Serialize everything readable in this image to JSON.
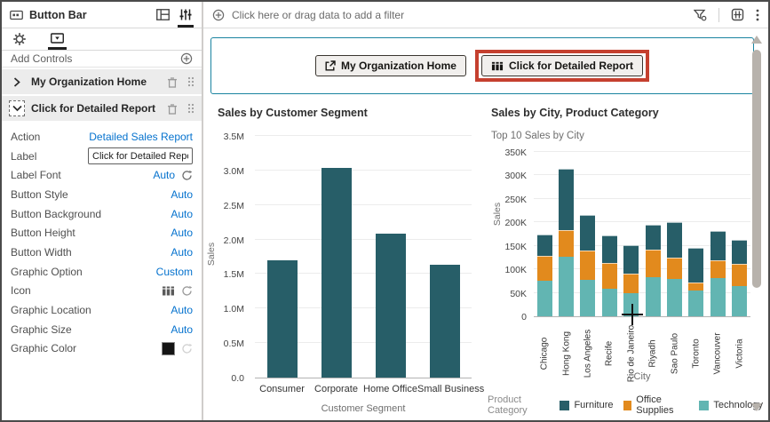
{
  "sidebar": {
    "title": "Button Bar",
    "add_controls_label": "Add Controls",
    "controls": [
      {
        "label": "My Organization Home",
        "state": "collapsed"
      },
      {
        "label": "Click for Detailed Report",
        "state": "selected"
      }
    ],
    "properties": [
      {
        "label": "Action",
        "value": "Detailed Sales Report"
      },
      {
        "label": "Label",
        "value": "Click for Detailed Report"
      },
      {
        "label": "Label Font",
        "value": "Auto"
      },
      {
        "label": "Button Style",
        "value": "Auto"
      },
      {
        "label": "Button Background",
        "value": "Auto"
      },
      {
        "label": "Button Height",
        "value": "Auto"
      },
      {
        "label": "Button Width",
        "value": "Auto"
      },
      {
        "label": "Graphic Option",
        "value": "Custom"
      },
      {
        "label": "Icon",
        "value": "table-icon"
      },
      {
        "label": "Graphic Location",
        "value": "Auto"
      },
      {
        "label": "Graphic Size",
        "value": "Auto"
      },
      {
        "label": "Graphic Color",
        "value": "#141414"
      }
    ]
  },
  "filter_bar": {
    "prompt": "Click here or drag data to add a filter"
  },
  "canvas": {
    "buttons": [
      {
        "label": "My Organization Home",
        "icon": "open-in-new-icon"
      },
      {
        "label": "Click for Detailed Report",
        "icon": "table-icon",
        "highlighted": true
      }
    ],
    "annotation": {
      "type": "highlight-box",
      "color": "#C5402F",
      "target": "Click for Detailed Report"
    }
  },
  "icons": {
    "button-bar-icon": "rect with buttons",
    "gear-icon": "settings gear",
    "button-control-icon": "rect with down triangle",
    "plus-circle-icon": "circled plus",
    "trash-icon": "delete",
    "drag-handle-icon": "six dots",
    "filter-funnel-icon": "funnel",
    "canvas-grid-icon": "rounded grid",
    "kebab-menu-icon": "vertical dots",
    "open-in-new-icon": "square with arrow",
    "table-icon": "column grid",
    "refresh-icon": "circular arrow",
    "layout-panels-icon": "panel layout",
    "sliders-icon": "properties sliders"
  },
  "colors": {
    "link_blue": "#0572CE",
    "panel_border_teal": "#1A84A0",
    "annotation_red": "#C5402F",
    "furniture": "#275E68",
    "office_supplies": "#E28A1D",
    "technology": "#62B5B2"
  },
  "chart_data": [
    {
      "type": "bar",
      "title": "Sales by Customer Segment",
      "xlabel": "Customer Segment",
      "ylabel": "Sales",
      "categories": [
        "Consumer",
        "Corporate",
        "Home Office",
        "Small Business"
      ],
      "values": [
        1700000,
        3040000,
        2090000,
        1630000
      ],
      "bar_color": "#275E68",
      "ylim": [
        0,
        3500000
      ],
      "ytick_values": [
        0,
        500000,
        1000000,
        1500000,
        2000000,
        2500000,
        3000000,
        3500000
      ],
      "ytick_labels": [
        "0.0",
        "0.5M",
        "1.0M",
        "1.5M",
        "2.0M",
        "2.5M",
        "3.0M",
        "3.5M"
      ],
      "grid": true,
      "legend": null
    },
    {
      "type": "bar",
      "stacked": true,
      "title": "Sales by City, Product Category",
      "subtitle": "Top 10 Sales by City",
      "xlabel": "City",
      "ylabel": "Sales",
      "categories": [
        "Chicago",
        "Hong Kong",
        "Los Angeles",
        "Recife",
        "Rio de Janeiro",
        "Riyadh",
        "Sao Paulo",
        "Toronto",
        "Vancouver",
        "Victoria"
      ],
      "series": [
        {
          "name": "Technology",
          "color": "#62B5B2",
          "values": [
            75000,
            127000,
            77000,
            59000,
            49000,
            83000,
            80000,
            55000,
            81000,
            64000
          ]
        },
        {
          "name": "Office Supplies",
          "color": "#E28A1D",
          "values": [
            53000,
            56000,
            63000,
            54000,
            42000,
            58000,
            44000,
            17000,
            39000,
            48000
          ]
        },
        {
          "name": "Furniture",
          "color": "#275E68",
          "values": [
            47000,
            132000,
            75000,
            59000,
            60000,
            53000,
            76000,
            74000,
            62000,
            51000
          ]
        }
      ],
      "stack_order": "bottom-to-top: Technology, Office Supplies, Furniture",
      "ylim": [
        0,
        350000
      ],
      "ytick_values": [
        0,
        50000,
        100000,
        150000,
        200000,
        250000,
        300000,
        350000
      ],
      "ytick_labels": [
        "0",
        "50K",
        "100K",
        "150K",
        "200K",
        "250K",
        "300K",
        "350K"
      ],
      "grid": true,
      "legend_title": "Product Category",
      "legend": [
        {
          "label": "Furniture",
          "color": "#275E68"
        },
        {
          "label": "Office Supplies",
          "color": "#E28A1D"
        },
        {
          "label": "Technology",
          "color": "#62B5B2"
        }
      ],
      "legend_position": "bottom"
    }
  ]
}
